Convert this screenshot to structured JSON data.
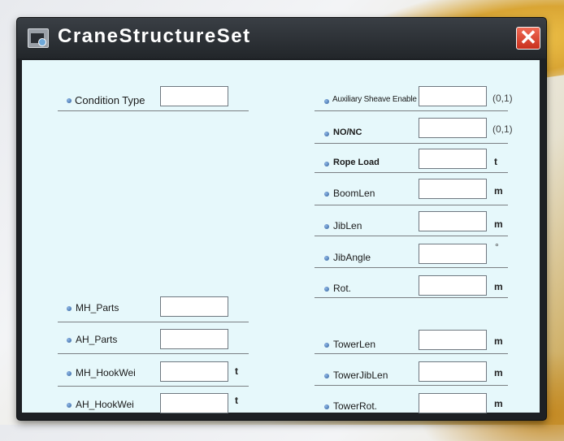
{
  "dialog": {
    "title": "CraneStructureSet",
    "close_label": "✕"
  },
  "left_fields": [
    {
      "label": "Condition Type",
      "value": "",
      "unit": ""
    },
    {
      "label": "MH_Parts",
      "value": "",
      "unit": ""
    },
    {
      "label": "AH_Parts",
      "value": "",
      "unit": ""
    },
    {
      "label": "MH_HookWei",
      "value": "",
      "unit": "t"
    },
    {
      "label": "AH_HookWei",
      "value": "",
      "unit": "t"
    }
  ],
  "right_fields": [
    {
      "label": "Auxiliary Sheave Enable",
      "value": "",
      "unit": "(0,1)"
    },
    {
      "label": "NO/NC",
      "value": "",
      "unit": "(0,1)"
    },
    {
      "label": "Rope Load",
      "value": "",
      "unit": "t"
    },
    {
      "label": "BoomLen",
      "value": "",
      "unit": "m"
    },
    {
      "label": "JibLen",
      "value": "",
      "unit": "m"
    },
    {
      "label": "JibAngle",
      "value": "",
      "unit": "°"
    },
    {
      "label": "Rot.",
      "value": "",
      "unit": "m"
    },
    {
      "label": "TowerLen",
      "value": "",
      "unit": "m"
    },
    {
      "label": "TowerJibLen",
      "value": "",
      "unit": "m"
    },
    {
      "label": "TowerRot.",
      "value": "",
      "unit": "m"
    }
  ]
}
